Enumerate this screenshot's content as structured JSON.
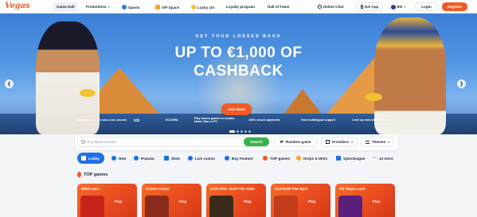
{
  "header": {
    "logo": "Vegas",
    "nav": [
      {
        "label": "Game Hall",
        "icon": "",
        "active": true
      },
      {
        "label": "Promotions",
        "icon": "chevron-down-icon",
        "active": false
      },
      {
        "label": "Sports",
        "icon": "sports-ball-icon",
        "active": false
      },
      {
        "label": "VIP Space",
        "icon": "crown-icon",
        "active": false
      },
      {
        "label": "Lucky 10!",
        "icon": "clover-icon",
        "active": false
      },
      {
        "label": "Loyalty program",
        "icon": "",
        "active": false
      },
      {
        "label": "Hall of Fame",
        "icon": "",
        "active": false
      }
    ],
    "online_chat": "Online Chat",
    "get_app": "Get App",
    "language": "EN",
    "login": "Login",
    "register": "Register"
  },
  "hero": {
    "subtitle": "GET YOUR LOSSES BACK",
    "title_line1": "UP TO €1,000 OF",
    "title_line2": "CASHBACK",
    "cta": "Join Now!",
    "approved_by": "Approved by",
    "badge_1": "CASINO GURU AWARDS",
    "badge_2": "icb",
    "badge_3": "ECOGRA",
    "play_note": "Play casino games on mobile, tablet, Mac or PC",
    "trust_1": "100% secure payments",
    "trust_2": "Fast multilingual support",
    "trust_3": "Level up and collect rewards",
    "slide_count": 5,
    "active_slide": 1
  },
  "search": {
    "placeholder": "E.g. Book of Dead",
    "button": "Search",
    "random_game": "Random game",
    "providers": "Providers",
    "themes": "Themes"
  },
  "categories": [
    {
      "label": "Lobby",
      "icon": "home-icon",
      "active": true
    },
    {
      "label": "New",
      "icon": "new-icon",
      "active": false
    },
    {
      "label": "Popular",
      "icon": "popular-icon",
      "active": false
    },
    {
      "label": "Slots",
      "icon": "slots-icon",
      "active": false
    },
    {
      "label": "Live casino",
      "icon": "live-icon",
      "active": false
    },
    {
      "label": "Buy Feature",
      "icon": "buy-icon",
      "active": false
    },
    {
      "label": "TOP games",
      "icon": "flame-icon",
      "active": false
    },
    {
      "label": "Drops & Wins",
      "icon": "drops-icon",
      "active": false
    },
    {
      "label": "Spinoleague",
      "icon": "league-icon",
      "active": false
    },
    {
      "label": "13 more",
      "icon": "more-icon",
      "active": false
    }
  ],
  "top_games": {
    "title": "TOP games",
    "play_label": "Play",
    "items": [
      {
        "name": "Wild Lava",
        "thumb_color": "#c8231a"
      },
      {
        "name": "Crown Coins",
        "thumb_color": "#8a2b1c"
      },
      {
        "name": "Coin Win: Hold The Spin",
        "thumb_color": "#3a2a1a"
      },
      {
        "name": "3x3 Hold The Spin",
        "thumb_color": "#c23c1a"
      },
      {
        "name": "All Ways Luck",
        "thumb_color": "#5a1f7a"
      }
    ]
  },
  "colors": {
    "brand": "#f15a24",
    "primary_blue": "#1f6fe5",
    "search_green": "#37b34a"
  }
}
